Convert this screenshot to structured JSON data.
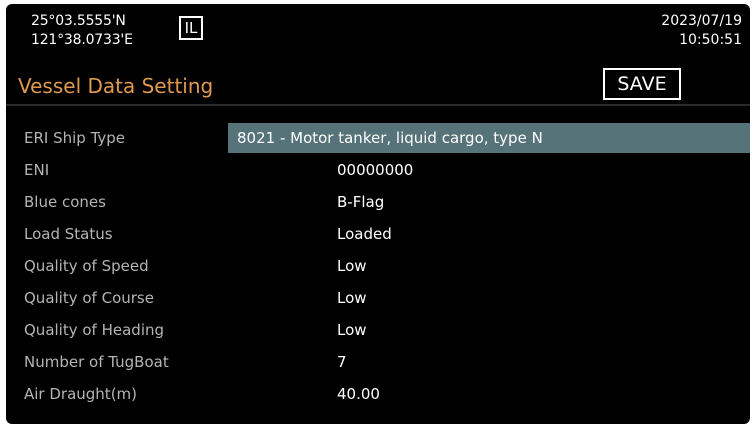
{
  "header": {
    "latitude": "25°03.5555'N",
    "longitude": "121°38.0733'E",
    "mode_indicator": "IL",
    "date": "2023/07/19",
    "time": "10:50:51"
  },
  "page": {
    "title": "Vessel Data Setting",
    "save_label": "SAVE"
  },
  "settings": [
    {
      "label": "ERI Ship Type",
      "value": "8021 - Motor tanker, liquid cargo, type N",
      "selected": true
    },
    {
      "label": "ENI",
      "value": "00000000"
    },
    {
      "label": "Blue cones",
      "value": "B-Flag"
    },
    {
      "label": "Load Status",
      "value": "Loaded"
    },
    {
      "label": "Quality of Speed",
      "value": "Low"
    },
    {
      "label": "Quality of Course",
      "value": "Low"
    },
    {
      "label": "Quality of Heading",
      "value": "Low"
    },
    {
      "label": "Number of TugBoat",
      "value": "7"
    },
    {
      "label": "Air Draught(m)",
      "value": "40.00"
    }
  ],
  "colors": {
    "title_accent": "#e09a50",
    "selection_highlight": "#56737a",
    "label_gray": "#b4b4b4",
    "background": "#000000"
  }
}
